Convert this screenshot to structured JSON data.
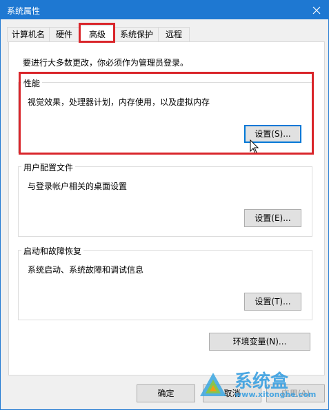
{
  "window": {
    "title": "系统属性"
  },
  "tabs": [
    "计算机名",
    "硬件",
    "高级",
    "系统保护",
    "远程"
  ],
  "active_tab": "高级",
  "notice": "要进行大多数更改，你必须作为管理员登录。",
  "groups": {
    "performance": {
      "label": "性能",
      "description": "视觉效果，处理器计划，内存使用，以及虚拟内存",
      "button": "设置(S)..."
    },
    "profile": {
      "label": "用户配置文件",
      "description": "与登录帐户相关的桌面设置",
      "button": "设置(E)..."
    },
    "startup": {
      "label": "启动和故障恢复",
      "description": "系统启动、系统故障和调试信息",
      "button": "设置(T)..."
    }
  },
  "env_button": "环境变量(N)...",
  "footer": {
    "ok": "确定",
    "cancel": "取消",
    "apply": "应用(A)"
  },
  "watermark": {
    "brand": "系统盒",
    "url": "www.xitonghe.com"
  },
  "colors": {
    "titlebar": "#1e78d2",
    "highlight": "#d9252a",
    "focus": "#0078d7"
  }
}
